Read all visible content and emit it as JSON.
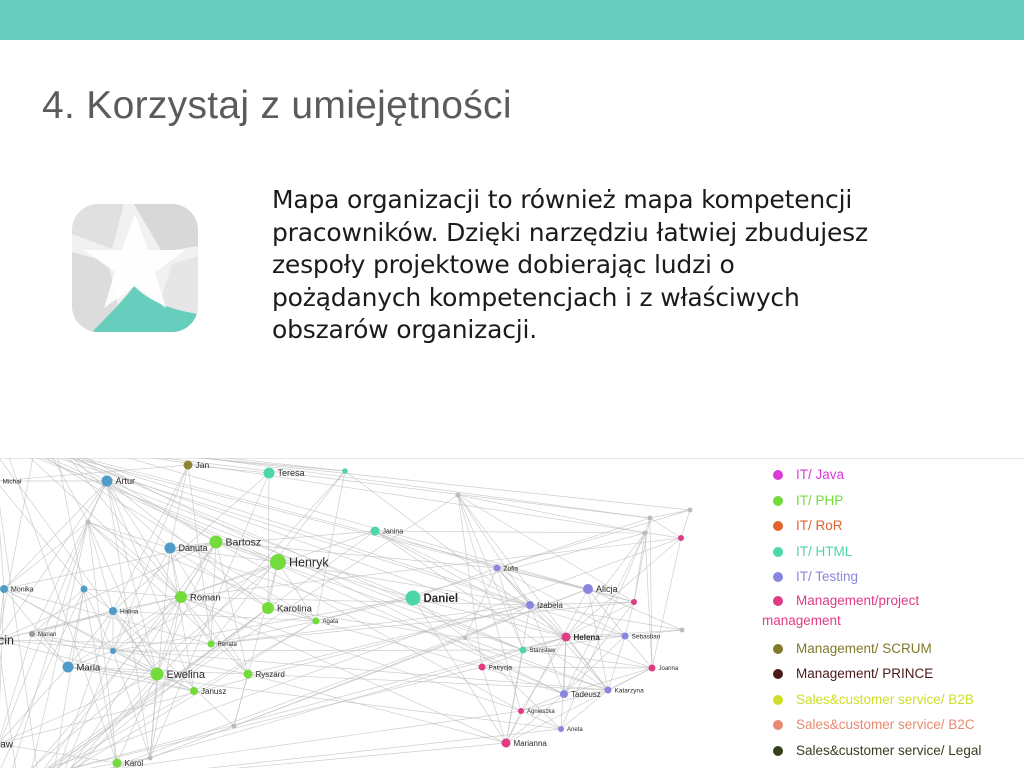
{
  "slide": {
    "title": "4. Korzystaj z umiejętności",
    "body_lines": [
      "Mapa organizacji to również mapa kompetencji",
      "pracowników. Dzięki narzędziu łatwiej zbudujesz",
      "zespoły projektowe dobierając ludzi o",
      "pożądanych kompetencjach i z właściwych",
      "obszarów organizacji."
    ],
    "accent_color": "#67cdbd"
  },
  "legend": [
    {
      "label": "IT/ Java",
      "color": "#d93ad6"
    },
    {
      "label": "IT/ PHP",
      "color": "#73db3c"
    },
    {
      "label": "IT/ RoR",
      "color": "#e3622e"
    },
    {
      "label": "IT/ HTML",
      "color": "#4dd6a6"
    },
    {
      "label": "IT/ Testing",
      "color": "#8a86de"
    },
    {
      "label": "Management/project",
      "label_cont": "management",
      "color": "#e03b85"
    },
    {
      "label": "Management/ SCRUM",
      "color": "#807a2a"
    },
    {
      "label": "Management/ PRINCE",
      "color": "#4a1a1a"
    },
    {
      "label": "Sales&customer service/ B2B",
      "color": "#cfdd27"
    },
    {
      "label": "Sales&customer service/ B2C",
      "color": "#e98a70"
    },
    {
      "label": "Sales&customer service/ Legal",
      "color": "#33401f"
    }
  ],
  "nodes": [
    {
      "name": "Jan",
      "category": "Management/ SCRUM",
      "color": "#8e8633"
    },
    {
      "name": "Michał",
      "category": "",
      "color": "#4f9cc9"
    },
    {
      "name": "Artur",
      "category": "",
      "color": "#4f9cc9"
    },
    {
      "name": "Teresa",
      "category": "IT/ HTML",
      "color": "#4dd6a6"
    },
    {
      "name": "Danuta",
      "category": "",
      "color": "#4f9cc9"
    },
    {
      "name": "Bartosz",
      "category": "IT/ PHP",
      "color": "#73db3c"
    },
    {
      "name": "Henryk",
      "category": "IT/ PHP",
      "color": "#73db3c"
    },
    {
      "name": "Janina",
      "category": "IT/ HTML",
      "color": "#4dd6a6"
    },
    {
      "name": "Monika",
      "category": "",
      "color": "#4f9cc9"
    },
    {
      "name": "Roman",
      "category": "IT/ PHP",
      "color": "#73db3c"
    },
    {
      "name": "Karolina",
      "category": "IT/ PHP",
      "color": "#73db3c"
    },
    {
      "name": "Daniel",
      "category": "IT/ HTML",
      "color": "#4dd6a6"
    },
    {
      "name": "Zofia",
      "category": "IT/ Testing",
      "color": "#8a86de"
    },
    {
      "name": "Alicja",
      "category": "IT/ Testing",
      "color": "#8a86de"
    },
    {
      "name": "Halina",
      "category": "",
      "color": "#4f9cc9"
    },
    {
      "name": "Izabela",
      "category": "IT/ Testing",
      "color": "#8a86de"
    },
    {
      "name": "Agata",
      "category": "IT/ PHP",
      "color": "#73db3c"
    },
    {
      "name": "Marian",
      "category": "",
      "color": "#9a9a9a"
    },
    {
      "name": "Renata",
      "category": "IT/ PHP",
      "color": "#73db3c"
    },
    {
      "name": "Helena",
      "category": "Management/project management",
      "color": "#e03b85"
    },
    {
      "name": "Sebastian",
      "category": "IT/ Testing",
      "color": "#8a86de"
    },
    {
      "name": "Stanisław",
      "category": "IT/ HTML",
      "color": "#4dd6a6"
    },
    {
      "name": "cin",
      "category": "",
      "color": "#9a9a9a"
    },
    {
      "name": "Maria",
      "category": "",
      "color": "#4f9cc9"
    },
    {
      "name": "Ewelina",
      "category": "IT/ PHP",
      "color": "#73db3c"
    },
    {
      "name": "Ryszard",
      "category": "IT/ PHP",
      "color": "#73db3c"
    },
    {
      "name": "Patrycja",
      "category": "Management/project management",
      "color": "#e03b85"
    },
    {
      "name": "Joanna",
      "category": "Management/project management",
      "color": "#e03b85"
    },
    {
      "name": "Janusz",
      "category": "IT/ PHP",
      "color": "#73db3c"
    },
    {
      "name": "Tadeusz",
      "category": "IT/ Testing",
      "color": "#8a86de"
    },
    {
      "name": "Katarzyna",
      "category": "IT/ Testing",
      "color": "#8a86de"
    },
    {
      "name": "Agnieszka",
      "category": "Management/project management",
      "color": "#e03b85"
    },
    {
      "name": "Aneta",
      "category": "IT/ Testing",
      "color": "#8a86de"
    },
    {
      "name": "ław",
      "category": "",
      "color": "#9a9a9a"
    },
    {
      "name": "Marianna",
      "category": "Management/project management",
      "color": "#e03b85"
    },
    {
      "name": "Karol",
      "category": "IT/ PHP",
      "color": "#73db3c"
    }
  ]
}
